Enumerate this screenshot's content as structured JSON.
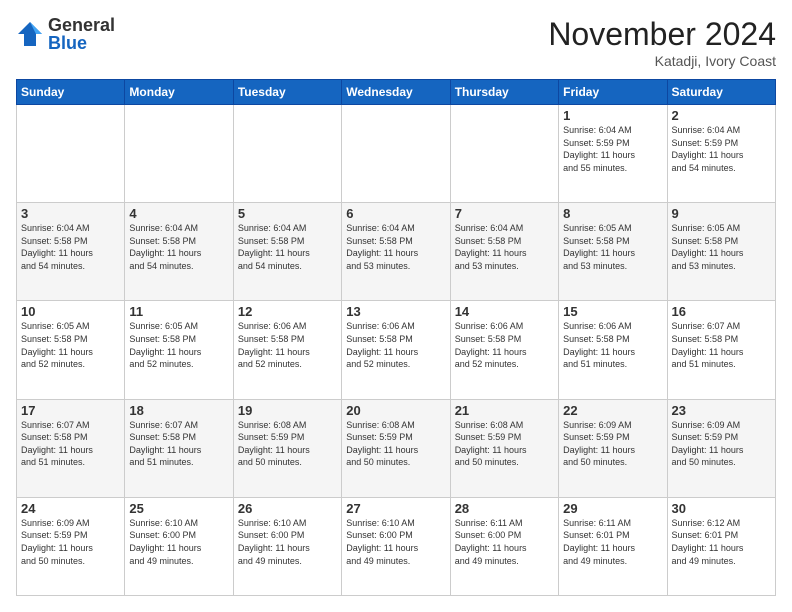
{
  "logo": {
    "general": "General",
    "blue": "Blue"
  },
  "title": "November 2024",
  "location": "Katadji, Ivory Coast",
  "header_days": [
    "Sunday",
    "Monday",
    "Tuesday",
    "Wednesday",
    "Thursday",
    "Friday",
    "Saturday"
  ],
  "weeks": [
    [
      {
        "day": "",
        "info": ""
      },
      {
        "day": "",
        "info": ""
      },
      {
        "day": "",
        "info": ""
      },
      {
        "day": "",
        "info": ""
      },
      {
        "day": "",
        "info": ""
      },
      {
        "day": "1",
        "info": "Sunrise: 6:04 AM\nSunset: 5:59 PM\nDaylight: 11 hours\nand 55 minutes."
      },
      {
        "day": "2",
        "info": "Sunrise: 6:04 AM\nSunset: 5:59 PM\nDaylight: 11 hours\nand 54 minutes."
      }
    ],
    [
      {
        "day": "3",
        "info": "Sunrise: 6:04 AM\nSunset: 5:58 PM\nDaylight: 11 hours\nand 54 minutes."
      },
      {
        "day": "4",
        "info": "Sunrise: 6:04 AM\nSunset: 5:58 PM\nDaylight: 11 hours\nand 54 minutes."
      },
      {
        "day": "5",
        "info": "Sunrise: 6:04 AM\nSunset: 5:58 PM\nDaylight: 11 hours\nand 54 minutes."
      },
      {
        "day": "6",
        "info": "Sunrise: 6:04 AM\nSunset: 5:58 PM\nDaylight: 11 hours\nand 53 minutes."
      },
      {
        "day": "7",
        "info": "Sunrise: 6:04 AM\nSunset: 5:58 PM\nDaylight: 11 hours\nand 53 minutes."
      },
      {
        "day": "8",
        "info": "Sunrise: 6:05 AM\nSunset: 5:58 PM\nDaylight: 11 hours\nand 53 minutes."
      },
      {
        "day": "9",
        "info": "Sunrise: 6:05 AM\nSunset: 5:58 PM\nDaylight: 11 hours\nand 53 minutes."
      }
    ],
    [
      {
        "day": "10",
        "info": "Sunrise: 6:05 AM\nSunset: 5:58 PM\nDaylight: 11 hours\nand 52 minutes."
      },
      {
        "day": "11",
        "info": "Sunrise: 6:05 AM\nSunset: 5:58 PM\nDaylight: 11 hours\nand 52 minutes."
      },
      {
        "day": "12",
        "info": "Sunrise: 6:06 AM\nSunset: 5:58 PM\nDaylight: 11 hours\nand 52 minutes."
      },
      {
        "day": "13",
        "info": "Sunrise: 6:06 AM\nSunset: 5:58 PM\nDaylight: 11 hours\nand 52 minutes."
      },
      {
        "day": "14",
        "info": "Sunrise: 6:06 AM\nSunset: 5:58 PM\nDaylight: 11 hours\nand 52 minutes."
      },
      {
        "day": "15",
        "info": "Sunrise: 6:06 AM\nSunset: 5:58 PM\nDaylight: 11 hours\nand 51 minutes."
      },
      {
        "day": "16",
        "info": "Sunrise: 6:07 AM\nSunset: 5:58 PM\nDaylight: 11 hours\nand 51 minutes."
      }
    ],
    [
      {
        "day": "17",
        "info": "Sunrise: 6:07 AM\nSunset: 5:58 PM\nDaylight: 11 hours\nand 51 minutes."
      },
      {
        "day": "18",
        "info": "Sunrise: 6:07 AM\nSunset: 5:58 PM\nDaylight: 11 hours\nand 51 minutes."
      },
      {
        "day": "19",
        "info": "Sunrise: 6:08 AM\nSunset: 5:59 PM\nDaylight: 11 hours\nand 50 minutes."
      },
      {
        "day": "20",
        "info": "Sunrise: 6:08 AM\nSunset: 5:59 PM\nDaylight: 11 hours\nand 50 minutes."
      },
      {
        "day": "21",
        "info": "Sunrise: 6:08 AM\nSunset: 5:59 PM\nDaylight: 11 hours\nand 50 minutes."
      },
      {
        "day": "22",
        "info": "Sunrise: 6:09 AM\nSunset: 5:59 PM\nDaylight: 11 hours\nand 50 minutes."
      },
      {
        "day": "23",
        "info": "Sunrise: 6:09 AM\nSunset: 5:59 PM\nDaylight: 11 hours\nand 50 minutes."
      }
    ],
    [
      {
        "day": "24",
        "info": "Sunrise: 6:09 AM\nSunset: 5:59 PM\nDaylight: 11 hours\nand 50 minutes."
      },
      {
        "day": "25",
        "info": "Sunrise: 6:10 AM\nSunset: 6:00 PM\nDaylight: 11 hours\nand 49 minutes."
      },
      {
        "day": "26",
        "info": "Sunrise: 6:10 AM\nSunset: 6:00 PM\nDaylight: 11 hours\nand 49 minutes."
      },
      {
        "day": "27",
        "info": "Sunrise: 6:10 AM\nSunset: 6:00 PM\nDaylight: 11 hours\nand 49 minutes."
      },
      {
        "day": "28",
        "info": "Sunrise: 6:11 AM\nSunset: 6:00 PM\nDaylight: 11 hours\nand 49 minutes."
      },
      {
        "day": "29",
        "info": "Sunrise: 6:11 AM\nSunset: 6:01 PM\nDaylight: 11 hours\nand 49 minutes."
      },
      {
        "day": "30",
        "info": "Sunrise: 6:12 AM\nSunset: 6:01 PM\nDaylight: 11 hours\nand 49 minutes."
      }
    ]
  ]
}
